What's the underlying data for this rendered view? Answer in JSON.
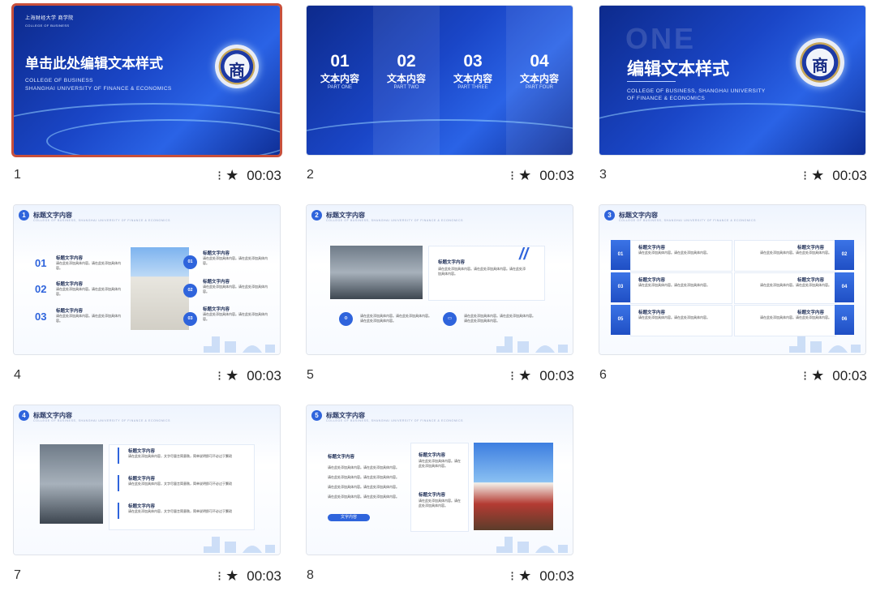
{
  "slides": [
    {
      "number": "1",
      "duration": "00:03",
      "selected": true,
      "title": "单击此处编辑文本样式",
      "sub1": "COLLEGE OF BUSINESS",
      "sub2": "SHANGHAI UNIVERSITY OF FINANCE & ECONOMICS",
      "logo": "上海财经大学 商学院",
      "logo_en": "COLLEGE OF BUSINESS",
      "seal": "商"
    },
    {
      "number": "2",
      "duration": "00:03",
      "parts": [
        {
          "num": "01",
          "title": "文本内容",
          "en": "PART ONE"
        },
        {
          "num": "02",
          "title": "文本内容",
          "en": "PART TWO"
        },
        {
          "num": "03",
          "title": "文本内容",
          "en": "PART THREE"
        },
        {
          "num": "04",
          "title": "文本内容",
          "en": "PART FOUR"
        }
      ]
    },
    {
      "number": "3",
      "duration": "00:03",
      "bg_word": "ONE",
      "title": "编辑文本样式",
      "sub1": "COLLEGE OF BUSINESS, SHANGHAI UNIVERSITY",
      "sub2": "OF FINANCE & ECONOMICS",
      "seal": "商"
    },
    {
      "number": "4",
      "duration": "00:03",
      "badge": "1",
      "header": "标题文字内容",
      "header_sub": "COLLEGE OF BUSINESS, SHANGHAI UNIVERSITY OF FINANCE & ECONOMICS",
      "item_title": "标题文字内容",
      "item_body": "请在此处添加具体内容。请在此处添加具体内容。",
      "nums": [
        "01",
        "02",
        "03"
      ]
    },
    {
      "number": "5",
      "duration": "00:03",
      "badge": "2",
      "header": "标题文字内容",
      "header_sub": "COLLEGE OF BUSINESS, SHANGHAI UNIVERSITY OF FINANCE & ECONOMICS",
      "item_title": "标题文字内容",
      "item_body": "请在此处添加具体内容。请在此处添加具体内容。请在此处添加具体内容。"
    },
    {
      "number": "6",
      "duration": "00:03",
      "badge": "3",
      "header": "标题文字内容",
      "header_sub": "COLLEGE OF BUSINESS, SHANGHAI UNIVERSITY OF FINANCE & ECONOMICS",
      "item_title": "标题文字内容",
      "item_body": "请在此处添加具体内容。请在此处添加具体内容。",
      "left_nums": [
        "01",
        "03",
        "05"
      ],
      "right_nums": [
        "02",
        "04",
        "06"
      ]
    },
    {
      "number": "7",
      "duration": "00:03",
      "badge": "4",
      "header": "标题文字内容",
      "header_sub": "COLLEGE OF BUSINESS, SHANGHAI UNIVERSITY OF FINANCE & ECONOMICS",
      "item_title": "标题文字内容",
      "item_body": "请在此处添加具体内容，文字尽量言简意赅，简单说明即可不必过于繁琐"
    },
    {
      "number": "8",
      "duration": "00:03",
      "badge": "5",
      "header": "标题文字内容",
      "header_sub": "COLLEGE OF BUSINESS, SHANGHAI UNIVERSITY OF FINANCE & ECONOMICS",
      "item_title": "标题文字内容",
      "item_body": "请在此处添加具体内容。请在此处添加具体内容。",
      "pill": "文字内容"
    }
  ],
  "icons": {
    "animation": "animation-icon",
    "star": "star-icon"
  },
  "colors": {
    "accent": "#2f64dc",
    "selection": "#c8503c"
  }
}
